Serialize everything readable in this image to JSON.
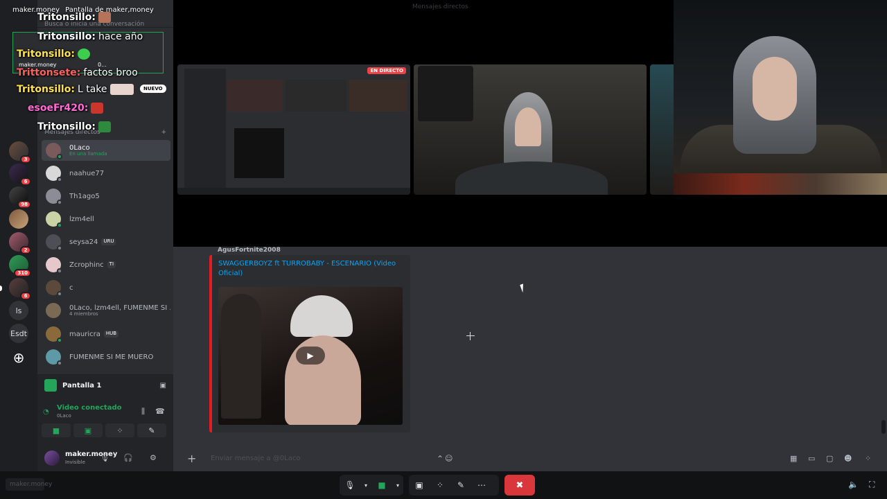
{
  "app": {
    "title": "Mensajes directos",
    "search_placeholder": "Busca o inicia una conversación"
  },
  "servers": {
    "badges": [
      "3",
      "6",
      "98",
      "2",
      "310",
      "6"
    ],
    "text_servers": [
      "ls",
      "Esdt"
    ]
  },
  "dm_list": {
    "section_title": "Mensajes directos",
    "items": [
      {
        "name": "0Laco",
        "sub": "En una llamada",
        "active": true
      },
      {
        "name": "naahue77",
        "sub": ""
      },
      {
        "name": "Th1ago5",
        "sub": ""
      },
      {
        "name": "lzm4ell",
        "sub": ""
      },
      {
        "name": "seysa24",
        "sub": "",
        "tag": "URU"
      },
      {
        "name": "Zcrophinc",
        "sub": "",
        "tag": "TI"
      },
      {
        "name": "c",
        "sub": ""
      },
      {
        "name": "0Laco, lzm4ell, FUMENME SI ...",
        "sub": "4 miembros"
      },
      {
        "name": "mauricra",
        "sub": "",
        "tag": "HUB"
      },
      {
        "name": "FUMENME SI ME MUERO",
        "sub": ""
      }
    ]
  },
  "voice_panel": {
    "screen_label": "Pantalla 1",
    "status": "Video conectado",
    "channel": "0Laco"
  },
  "user": {
    "name": "maker.money",
    "status": "Invisible"
  },
  "stage": {
    "live_label": "EN DIRECTO"
  },
  "message": {
    "author": "AgusFortnite2008",
    "embed_title": "SWAGGERBOYZ ft TURROBABY - ESCENARIO (Video Oficial)"
  },
  "composer": {
    "placeholder": "Enviar mensaje a @0Laco"
  },
  "overlay": {
    "header_user": "maker.money",
    "header_screen": "Pantalla de maker,money",
    "pip_name": "maker.money",
    "pip_dots": "0...",
    "new_badge": "NUEVO",
    "lines": [
      {
        "name": "Tritonsillo:",
        "text": "",
        "color": "w"
      },
      {
        "name": "Tritonsillo:",
        "text": "hace año",
        "color": "w"
      },
      {
        "name": "Tritonsillo:",
        "text": "",
        "color": "y"
      },
      {
        "name": "Trittonsete:",
        "text": "factos broo",
        "color": "r"
      },
      {
        "name": "Tritonsillo:",
        "text": "L take",
        "color": "y"
      },
      {
        "name": "esoeFr420:",
        "text": "",
        "color": "p"
      },
      {
        "name": "Tritonsillo:",
        "text": "",
        "color": "w"
      }
    ]
  },
  "bottom": {
    "left_label": "maker.money"
  }
}
